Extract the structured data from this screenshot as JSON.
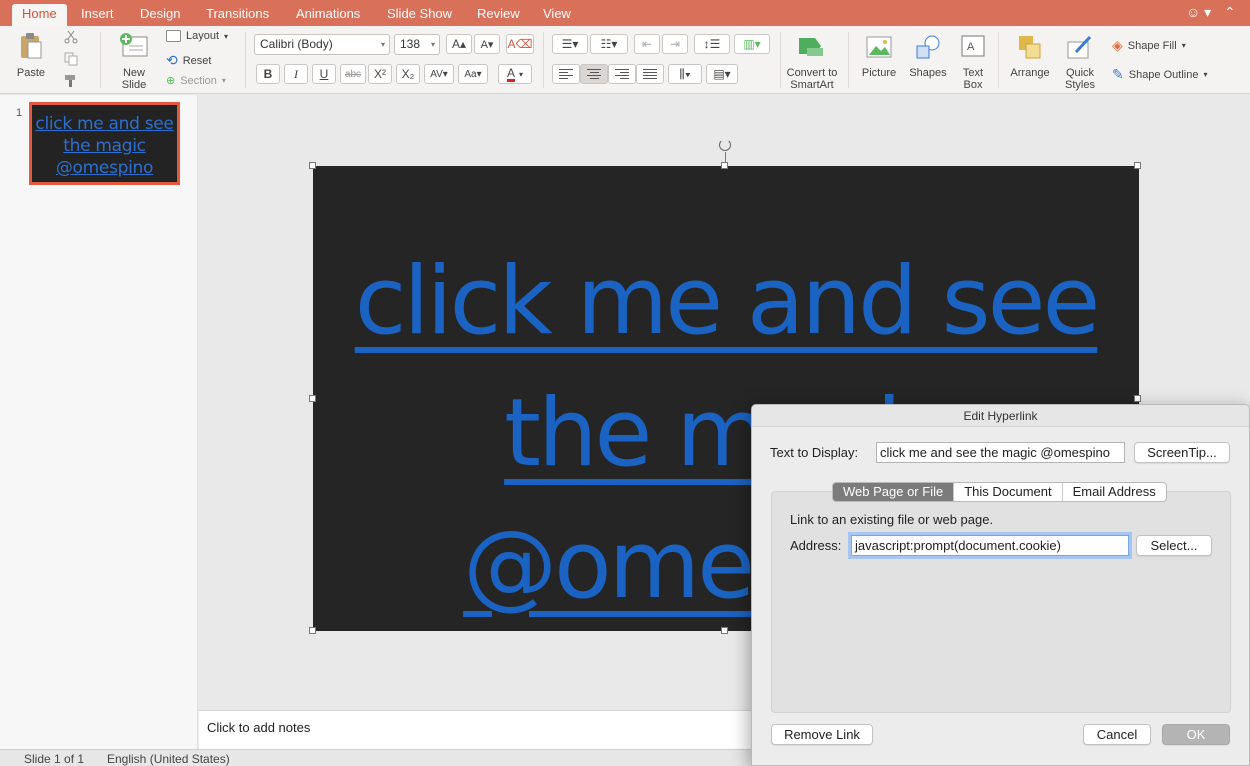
{
  "tabs": [
    "Home",
    "Insert",
    "Design",
    "Transitions",
    "Animations",
    "Slide Show",
    "Review",
    "View"
  ],
  "ribbon": {
    "paste": "Paste",
    "new_slide": [
      "New",
      "Slide"
    ],
    "layout": "Layout",
    "reset": "Reset",
    "section": "Section",
    "font_name": "Calibri (Body)",
    "font_size": "138",
    "bold": "B",
    "italic": "I",
    "underline": "U",
    "strike": "abc",
    "superscript": "X²",
    "subscript": "X₂",
    "convert_smartart": [
      "Convert to",
      "SmartArt"
    ],
    "picture": "Picture",
    "shapes": "Shapes",
    "textbox": [
      "Text",
      "Box"
    ],
    "arrange": "Arrange",
    "quick_styles": [
      "Quick",
      "Styles"
    ],
    "shape_fill": "Shape Fill",
    "shape_outline": "Shape Outline"
  },
  "thumbnails": [
    {
      "number": "1",
      "text": "click me and see the magic @omespino"
    }
  ],
  "slide": {
    "lines": [
      "click me and see",
      "the magic",
      "@omespino"
    ]
  },
  "notes_placeholder": "Click to add notes",
  "status": {
    "slide": "Slide 1 of 1",
    "language": "English (United States)"
  },
  "dialog": {
    "title": "Edit Hyperlink",
    "text_to_display_label": "Text to Display:",
    "text_to_display_value": "click me and see the magic @omespino",
    "screentip": "ScreenTip...",
    "tabs": [
      "Web Page or File",
      "This Document",
      "Email Address"
    ],
    "active_tab": "Web Page or File",
    "hint": "Link to an existing file or web page.",
    "address_label": "Address:",
    "address_value": "javascript:prompt(document.cookie)",
    "select": "Select...",
    "remove_link": "Remove Link",
    "cancel": "Cancel",
    "ok": "OK"
  },
  "colors": {
    "accent": "#d9705a",
    "link": "#1a63c2",
    "slide_bg": "#252525"
  }
}
